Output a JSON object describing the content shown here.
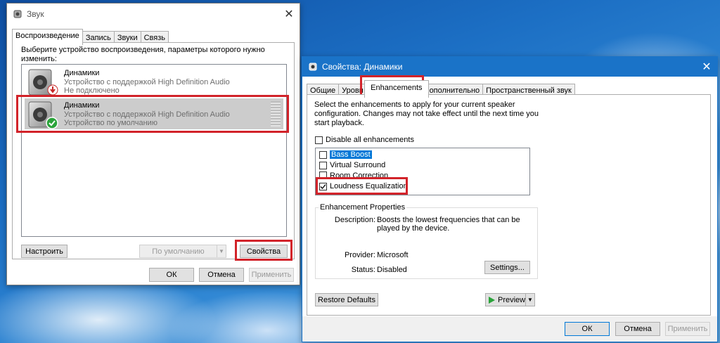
{
  "sound_dialog": {
    "title": "Звук",
    "tabs": [
      "Воспроизведение",
      "Запись",
      "Звуки",
      "Связь"
    ],
    "instruction": "Выберите устройство воспроизведения, параметры которого нужно изменить:",
    "devices": [
      {
        "name": "Динамики",
        "description": "Устройство с поддержкой High Definition Audio",
        "status": "Не подключено"
      },
      {
        "name": "Динамики",
        "description": "Устройство с поддержкой High Definition Audio",
        "status": "Устройство по умолчанию"
      }
    ],
    "configure_label": "Настроить",
    "default_label": "По умолчанию",
    "properties_label": "Свойства",
    "ok_label": "ОК",
    "cancel_label": "Отмена",
    "apply_label": "Применить"
  },
  "props_dialog": {
    "title": "Свойства: Динамики",
    "tabs": [
      "Общие",
      "Уровни",
      "Enhancements",
      "Дополнительно",
      "Пространственный звук"
    ],
    "tab_uroven": "Уровн",
    "tab_dop": "ополнительно",
    "intro": "Select the enhancements to apply for your current speaker configuration. Changes may not take effect until the next time you start playback.",
    "disable_all_label": "Disable all enhancements",
    "enhancements": [
      {
        "label": "Bass Boost",
        "checked": false
      },
      {
        "label": "Virtual Surround",
        "checked": false
      },
      {
        "label": "Room Correction",
        "checked": false
      },
      {
        "label": "Loudness Equalization",
        "checked": true
      }
    ],
    "props_group_label": "Enhancement Properties",
    "description_key": "Description:",
    "description_value": "Boosts the lowest frequencies that can be played by the device.",
    "provider_key": "Provider:",
    "provider_value": "Microsoft",
    "status_key": "Status:",
    "status_value": "Disabled",
    "settings_label": "Settings...",
    "restore_label": "Restore Defaults",
    "preview_label": "Preview",
    "ok_label": "ОК",
    "cancel_label": "Отмена",
    "apply_label": "Применить"
  },
  "colors": {
    "highlight_red": "#d2232a",
    "selection_blue": "#0078d7",
    "check_green": "#2aa33a"
  }
}
